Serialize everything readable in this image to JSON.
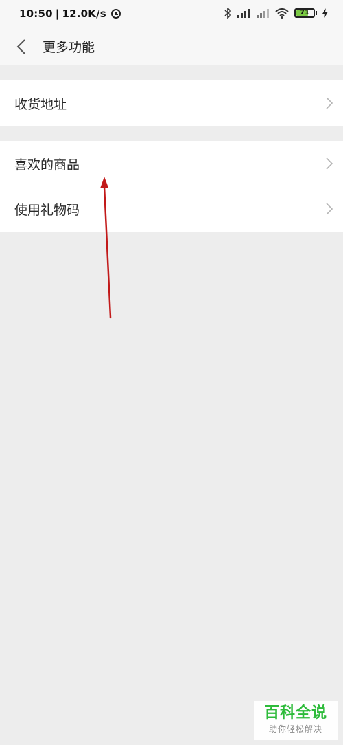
{
  "status_bar": {
    "time": "10:50",
    "network_speed": "12.0K/s",
    "battery_level": "71",
    "battery_fill_fraction": 0.71,
    "icons": [
      "data-saver-icon",
      "bluetooth-icon",
      "signal-icon",
      "signal-icon",
      "wifi-icon",
      "battery-icon",
      "charging-icon"
    ]
  },
  "header": {
    "title": "更多功能",
    "back_icon": "chevron-left-icon"
  },
  "groups": [
    {
      "items": [
        {
          "label": "收货地址"
        }
      ]
    },
    {
      "items": [
        {
          "label": "喜欢的商品"
        },
        {
          "label": "使用礼物码"
        }
      ]
    }
  ],
  "watermark": {
    "main": "百科全说",
    "sub": "助你轻松解决"
  },
  "colors": {
    "background": "#ededed",
    "card": "#ffffff",
    "arrow": "#c21a1a",
    "watermark": "#2dbb3a",
    "battery": "#7ac943"
  }
}
